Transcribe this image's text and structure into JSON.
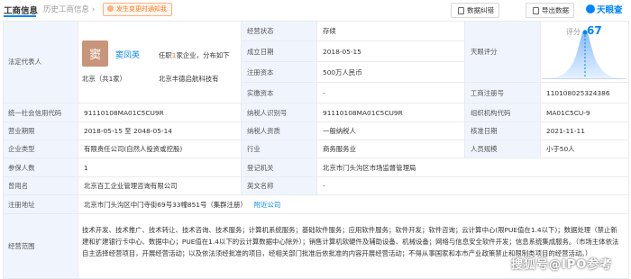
{
  "tabs": {
    "active": "工商信息",
    "inactive": "历史工商信息 ›"
  },
  "notify": "发生变更时通知我",
  "toolbar": {
    "correction": "数据纠错",
    "export": "导出数据",
    "logo": "天眼查"
  },
  "rep": {
    "label": "法定代表人",
    "avatar_char": "窦",
    "name": "窦凤英",
    "note_prefix": "任职",
    "note_count": "1",
    "note_suffix": "家企业，分布如下",
    "location": "北京（共1家）",
    "company": "北京丰德启航科技有"
  },
  "status": {
    "label": "经营状态",
    "value": "存续"
  },
  "established": {
    "label": "成立日期",
    "value": "2018-05-15"
  },
  "reg_capital": {
    "label": "注册资本",
    "value": "500万人民币"
  },
  "paid_capital": {
    "label": "实缴资本",
    "value": "-"
  },
  "score": {
    "label": "天眼评分",
    "score_prefix": "评分",
    "score_value": "67"
  },
  "reg_no": {
    "label": "工商注册号",
    "value": "110108025324386"
  },
  "credit_code": {
    "label": "统一社会信用代码",
    "value": "91110108MA01C5CU9R"
  },
  "taxpayer_id": {
    "label": "纳税人识别号",
    "value": "91110108MA01C5CU9R"
  },
  "org_code": {
    "label": "组织机构代码",
    "value": "MA01C5CU-9"
  },
  "term": {
    "label": "营业期限",
    "value": "2018-05-15 至 2048-05-14"
  },
  "taxpayer_type": {
    "label": "纳税人资质",
    "value": "一般纳税人"
  },
  "approval_date": {
    "label": "核准日期",
    "value": "2021-11-11"
  },
  "company_type": {
    "label": "企业类型",
    "value": "有限责任公司(自然人投资或控股)"
  },
  "industry": {
    "label": "行业",
    "value": "商务服务业"
  },
  "staff_size": {
    "label": "人员规模",
    "value": "小于50人"
  },
  "insured": {
    "label": "参保人数",
    "value": "1"
  },
  "authority": {
    "label": "登记机关",
    "value": "北京市门头沟区市场监督管理局"
  },
  "former_name": {
    "label": "曾用名",
    "value": "北京百工企业管理咨询有限公司"
  },
  "english_name": {
    "label": "英文名称",
    "value": "-"
  },
  "address": {
    "label": "注册地址",
    "value": "北京市门头沟区中门寺街69号33幢851号（集群注册）",
    "link": "附近公司"
  },
  "scope": {
    "label": "经营范围",
    "value": "技术开发、技术推广、技术转让、技术咨询、技术服务；计算机系统服务；基础软件服务；应用软件服务；软件开发；软件咨询；云计算中心(限PUE值在1.4以下)；数据处理（禁止新建和扩建银行卡中心、数据中心；PUE值在1.4以下的云计算数据中心除外）；销售计算机软硬件及辅助设备、机械设备；网络与信息安全软件开发；信息系统集成服务。（市场主体依法自主选择经营项目，开展经营活动；以及依法须经批准的项目，经相关部门批准后依批准的内容开展经营活动；不得从事国家和本市产业政策禁止和限制类项目的经营活动。）"
  },
  "watermark": "搜狐号@IPO参考",
  "colors": {
    "accent": "#0084ff",
    "label_bg": "#f0f5fd",
    "border": "#e8ebf0",
    "avatar": "#c8957a",
    "warn": "#ff7a1c"
  }
}
